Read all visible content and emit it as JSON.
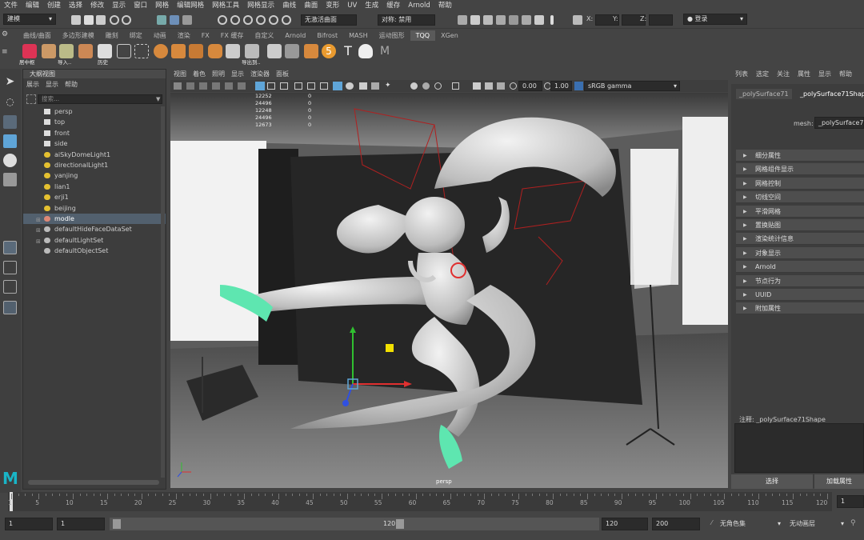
{
  "menubar": [
    "文件",
    "编辑",
    "创建",
    "选择",
    "修改",
    "显示",
    "窗口",
    "网格",
    "编辑网格",
    "网格工具",
    "网格显示",
    "曲线",
    "曲面",
    "变形",
    "UV",
    "生成",
    "缓存",
    "Arnold",
    "帮助"
  ],
  "statusline": {
    "mode_dropdown": "建模",
    "live_surface": "无激活曲面",
    "symmetry": "对称: 禁用",
    "x_label": "X:",
    "y_label": "Y:",
    "z_label": "Z:",
    "login": "登录"
  },
  "shelf_tabs": [
    "曲线/曲面",
    "多边形建模",
    "雕刻",
    "绑定",
    "动画",
    "渲染",
    "FX",
    "FX 缓存",
    "自定义",
    "Arnold",
    "Bifrost",
    "MASH",
    "运动图形",
    "TQQ",
    "XGen"
  ],
  "shelf_active": "TQQ",
  "shelf_labels": [
    "居中枢",
    "导入..",
    "历史",
    "导出到.."
  ],
  "outliner": {
    "title": "大纲视图",
    "menu": [
      "展示",
      "显示",
      "帮助"
    ],
    "search_placeholder": "搜索...",
    "items": [
      {
        "label": "persp",
        "icon": "camera-icon"
      },
      {
        "label": "top",
        "icon": "camera-icon"
      },
      {
        "label": "front",
        "icon": "camera-icon"
      },
      {
        "label": "side",
        "icon": "camera-icon"
      },
      {
        "label": "aiSkyDomeLight1",
        "icon": "skydome-light-icon"
      },
      {
        "label": "directionalLight1",
        "icon": "directional-light-icon"
      },
      {
        "label": "yanjing",
        "icon": "light-icon"
      },
      {
        "label": "lian1",
        "icon": "light-icon"
      },
      {
        "label": "erji1",
        "icon": "light-icon"
      },
      {
        "label": "beijing",
        "icon": "light-icon"
      },
      {
        "label": "modle",
        "icon": "group-icon",
        "selected": true,
        "expandable": true
      },
      {
        "label": "defaultHideFaceDataSet",
        "icon": "set-icon",
        "expandable": true
      },
      {
        "label": "defaultLightSet",
        "icon": "set-icon",
        "expandable": true
      },
      {
        "label": "defaultObjectSet",
        "icon": "set-icon"
      }
    ]
  },
  "viewport": {
    "menu": [
      "视图",
      "着色",
      "照明",
      "显示",
      "渲染器",
      "面板"
    ],
    "exposure": "0.00",
    "gamma": "1.00",
    "colorspace": "sRGB gamma",
    "camera_label": "persp",
    "hud_counts": [
      [
        "12252",
        "0"
      ],
      [
        "24496",
        "0"
      ],
      [
        "12248",
        "0"
      ],
      [
        "24496",
        "0"
      ],
      [
        "12673",
        "0"
      ]
    ]
  },
  "attribute_editor": {
    "menu": [
      "列表",
      "选定",
      "关注",
      "属性",
      "显示",
      "帮助"
    ],
    "tab1": "_polySurface71",
    "tab2": "_polySurface71Shape",
    "mesh_label": "mesh:",
    "mesh_value": "_polySurface71",
    "sections": [
      "细分属性",
      "网格组件显示",
      "网格控制",
      "切线空间",
      "平滑网格",
      "置换贴图",
      "渲染统计信息",
      "对象显示",
      "Arnold",
      "节点行为",
      "UUID",
      "附加属性"
    ],
    "notes_label": "注释: _polySurface71Shape",
    "select_button": "选择",
    "load_button": "加载属性"
  },
  "timeslider": {
    "ticks": [
      "1",
      "5",
      "10",
      "15",
      "20",
      "25",
      "30",
      "35",
      "40",
      "45",
      "50",
      "55",
      "60",
      "65",
      "70",
      "75",
      "80",
      "85",
      "90",
      "95",
      "100",
      "105",
      "110",
      "115",
      "120"
    ],
    "current_frame": "1"
  },
  "range": {
    "start": "1",
    "playback_start": "1",
    "slider_end": "120",
    "playback_end": "120",
    "anim_end": "200",
    "character_set": "无角色集",
    "anim_layer": "无动画层"
  },
  "colors": {
    "accent_blue": "#5fa5d8",
    "selection": "#52606e",
    "maya_logo": "#19b5c7",
    "gizmo_red": "#e03030",
    "gizmo_green": "#30c030",
    "gizmo_blue": "#3050e0",
    "shoe_green": "#5ee6b0"
  }
}
